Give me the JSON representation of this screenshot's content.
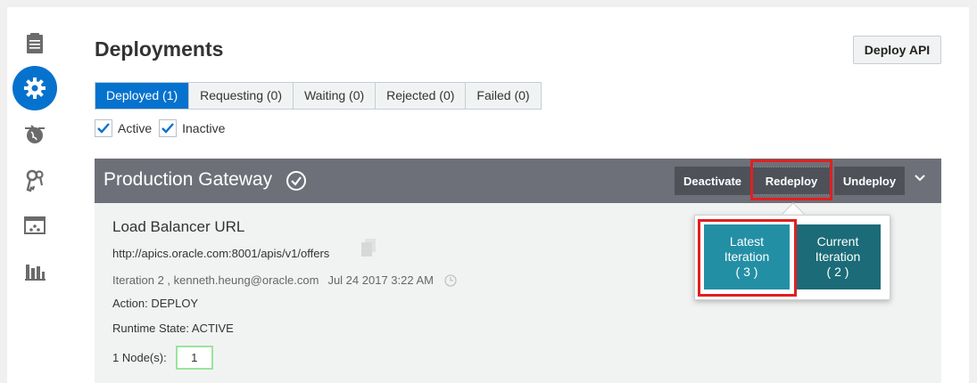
{
  "page": {
    "title": "Deployments",
    "deploy_button": "Deploy API"
  },
  "sidebar": {
    "items": [
      {
        "icon": "document-list-icon",
        "active": false
      },
      {
        "icon": "gear-icon",
        "active": true
      },
      {
        "icon": "globe-arrows-icon",
        "active": false
      },
      {
        "icon": "keys-icon",
        "active": false
      },
      {
        "icon": "app-window-icon",
        "active": false
      },
      {
        "icon": "bar-chart-icon",
        "active": false
      }
    ]
  },
  "tabs": [
    {
      "label": "Deployed (1)",
      "selected": true
    },
    {
      "label": "Requesting (0)",
      "selected": false
    },
    {
      "label": "Waiting (0)",
      "selected": false
    },
    {
      "label": "Rejected (0)",
      "selected": false
    },
    {
      "label": "Failed (0)",
      "selected": false
    }
  ],
  "filters": {
    "active_label": "Active",
    "active_checked": true,
    "inactive_label": "Inactive",
    "inactive_checked": true
  },
  "gateway": {
    "name": "Production Gateway",
    "deactivate_label": "Deactivate",
    "redeploy_label": "Redeploy",
    "undeploy_label": "Undeploy",
    "lb_title": "Load Balancer URL",
    "lb_url": "http://apics.oracle.com:8001/apis/v1/offers",
    "iteration": "Iteration 2 , kenneth.heung@oracle.com",
    "timestamp": "Jul 24 2017 3:22 AM",
    "action": "Action: DEPLOY",
    "runtime_state": "Runtime State: ACTIVE",
    "nodes_label": "1 Node(s):",
    "nodes_value": "1"
  },
  "redeploy_popover": {
    "latest_line1": "Latest",
    "latest_line2": "Iteration",
    "latest_line3": "( 3 )",
    "current_line1": "Current",
    "current_line2": "Iteration",
    "current_line3": "( 2 )"
  },
  "colors": {
    "accent": "#0572ce",
    "gateway_header": "#6e7079",
    "gateway_button": "#4f5159",
    "latest_button": "#238fa5",
    "current_button": "#1b6b78",
    "highlight": "#e02020"
  }
}
